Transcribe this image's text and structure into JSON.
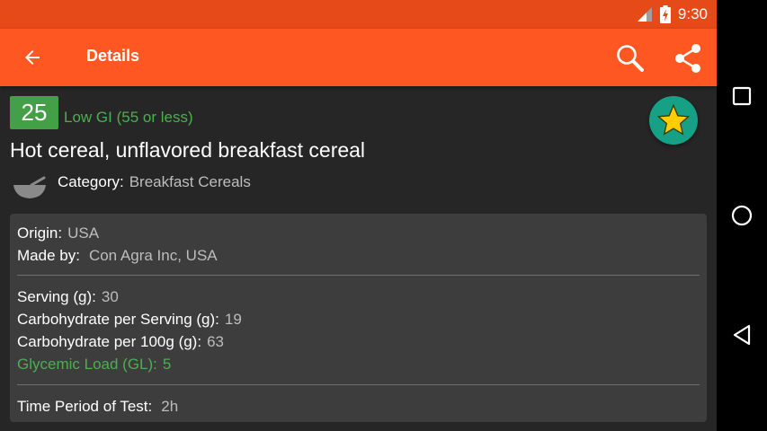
{
  "status_bar": {
    "time": "9:30"
  },
  "app_bar": {
    "title": "Details"
  },
  "gi": {
    "value": "25",
    "label": "Low GI (55 or less)"
  },
  "food": {
    "name": "Hot cereal, unflavored breakfast cereal",
    "category_label": "Category:",
    "category_value": "Breakfast Cereals"
  },
  "details": {
    "origin_label": "Origin:",
    "origin_value": "USA",
    "made_by_label": "Made by:",
    "made_by_value": "Con Agra Inc, USA",
    "serving_label": "Serving (g):",
    "serving_value": "30",
    "carb_serving_label": "Carbohydrate per Serving (g):",
    "carb_serving_value": "19",
    "carb_100g_label": "Carbohydrate per 100g (g):",
    "carb_100g_value": "63",
    "gl_label": "Glycemic Load (GL):",
    "gl_value": "5",
    "time_label": "Time Period of Test:",
    "time_value": "2h"
  },
  "colors": {
    "status_bar": "#e64a19",
    "app_bar": "#ff5722",
    "gi_badge": "#43a047",
    "gi_text": "#4caf50",
    "fav_button": "#16a085",
    "star": "#ffcc00"
  },
  "icons": {
    "back": "arrow-left-icon",
    "search": "search-icon",
    "share": "share-icon",
    "favorite": "star-icon",
    "category": "bowl-icon",
    "nav_recents": "square-icon",
    "nav_home": "circle-icon",
    "nav_back": "triangle-back-icon"
  }
}
